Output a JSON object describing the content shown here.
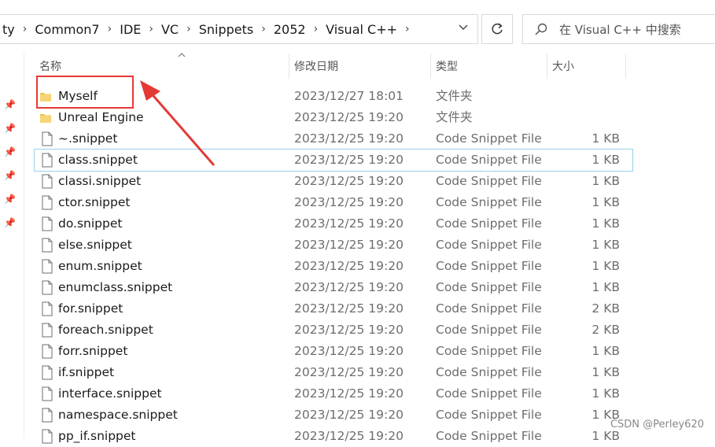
{
  "address": {
    "crumbs": [
      "ty",
      "Common7",
      "IDE",
      "VC",
      "Snippets",
      "2052",
      "Visual C++"
    ]
  },
  "search": {
    "placeholder": "在 Visual C++ 中搜索"
  },
  "columns": {
    "name": "名称",
    "date": "修改日期",
    "type": "类型",
    "size": "大小"
  },
  "files": [
    {
      "name": "Myself",
      "date": "2023/12/27 18:01",
      "type": "文件夹",
      "size": "",
      "icon": "folder-icon"
    },
    {
      "name": "Unreal Engine",
      "date": "2023/12/25 19:20",
      "type": "文件夹",
      "size": "",
      "icon": "folder-icon"
    },
    {
      "name": "~.snippet",
      "date": "2023/12/25 19:20",
      "type": "Code Snippet File",
      "size": "1 KB",
      "icon": "file-icon"
    },
    {
      "name": "class.snippet",
      "date": "2023/12/25 19:20",
      "type": "Code Snippet File",
      "size": "1 KB",
      "icon": "file-icon"
    },
    {
      "name": "classi.snippet",
      "date": "2023/12/25 19:20",
      "type": "Code Snippet File",
      "size": "1 KB",
      "icon": "file-icon"
    },
    {
      "name": "ctor.snippet",
      "date": "2023/12/25 19:20",
      "type": "Code Snippet File",
      "size": "1 KB",
      "icon": "file-icon"
    },
    {
      "name": "do.snippet",
      "date": "2023/12/25 19:20",
      "type": "Code Snippet File",
      "size": "1 KB",
      "icon": "file-icon"
    },
    {
      "name": "else.snippet",
      "date": "2023/12/25 19:20",
      "type": "Code Snippet File",
      "size": "1 KB",
      "icon": "file-icon"
    },
    {
      "name": "enum.snippet",
      "date": "2023/12/25 19:20",
      "type": "Code Snippet File",
      "size": "1 KB",
      "icon": "file-icon"
    },
    {
      "name": "enumclass.snippet",
      "date": "2023/12/25 19:20",
      "type": "Code Snippet File",
      "size": "1 KB",
      "icon": "file-icon"
    },
    {
      "name": "for.snippet",
      "date": "2023/12/25 19:20",
      "type": "Code Snippet File",
      "size": "2 KB",
      "icon": "file-icon"
    },
    {
      "name": "foreach.snippet",
      "date": "2023/12/25 19:20",
      "type": "Code Snippet File",
      "size": "2 KB",
      "icon": "file-icon"
    },
    {
      "name": "forr.snippet",
      "date": "2023/12/25 19:20",
      "type": "Code Snippet File",
      "size": "1 KB",
      "icon": "file-icon"
    },
    {
      "name": "if.snippet",
      "date": "2023/12/25 19:20",
      "type": "Code Snippet File",
      "size": "1 KB",
      "icon": "file-icon"
    },
    {
      "name": "interface.snippet",
      "date": "2023/12/25 19:20",
      "type": "Code Snippet File",
      "size": "1 KB",
      "icon": "file-icon"
    },
    {
      "name": "namespace.snippet",
      "date": "2023/12/25 19:20",
      "type": "Code Snippet File",
      "size": "1 KB",
      "icon": "file-icon"
    },
    {
      "name": "pp_if.snippet",
      "date": "2023/12/25 19:20",
      "type": "Code Snippet File",
      "size": "1 KB",
      "icon": "file-icon"
    }
  ],
  "selected_index": 3,
  "watermark": "CSDN @Perley620",
  "colors": {
    "annotation": "#e53935",
    "selection": "#99d1ea",
    "folder": "#f2c14e"
  }
}
